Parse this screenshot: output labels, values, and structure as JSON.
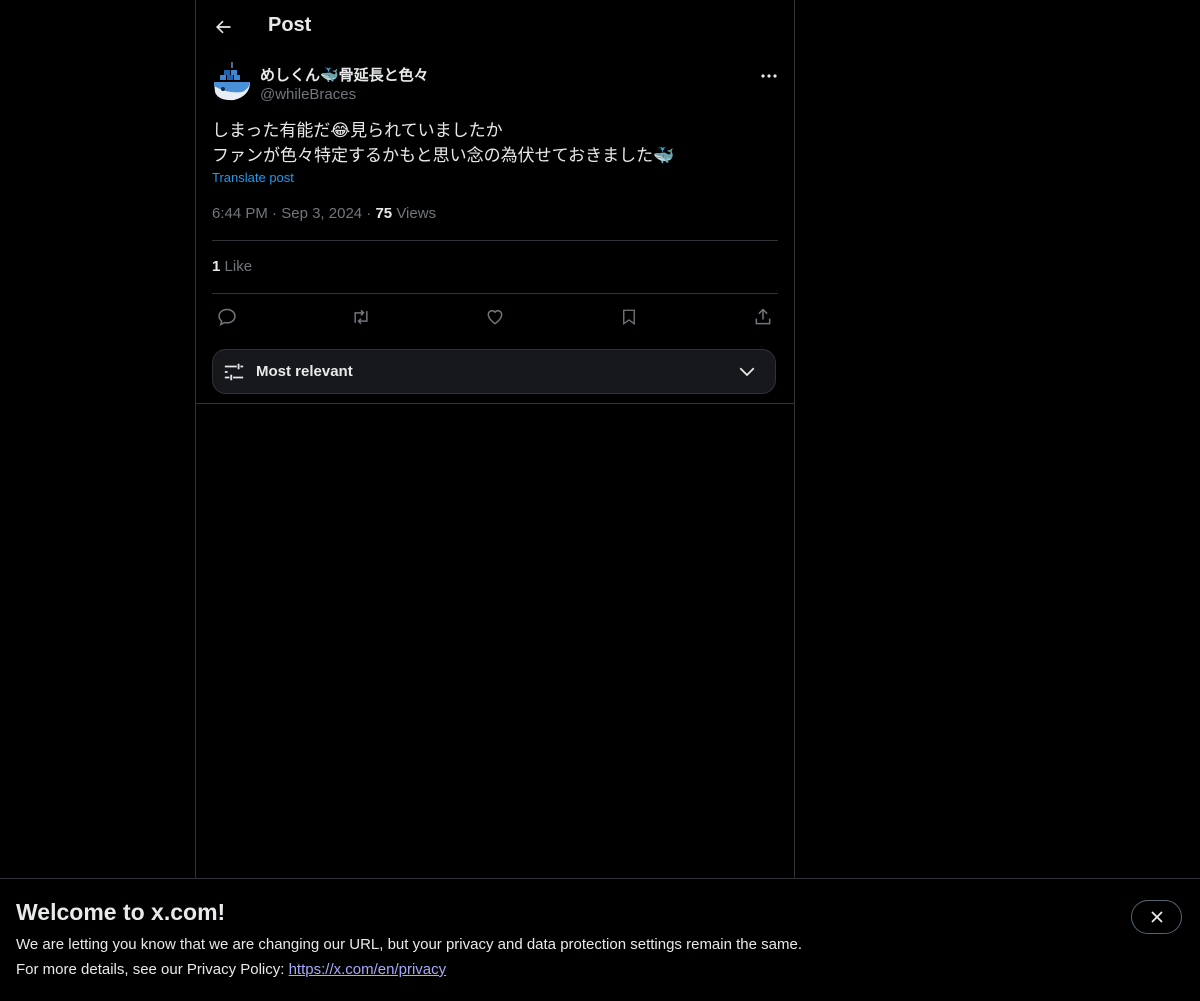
{
  "header": {
    "title": "Post",
    "back_icon": "arrow-left-icon"
  },
  "post": {
    "author_name": "めしくん🐳骨延長と色々",
    "author_handle": "@whileBraces",
    "text": "しまった有能だ😂見られていましたか\nファンが色々特定するかもと思い念の為伏せておきました🐳",
    "translate_label": "Translate post",
    "time": "6:44 PM",
    "date": "Sep 3, 2024",
    "views_count": "75",
    "views_label": "Views",
    "likes_count": "1",
    "likes_label": "Like"
  },
  "actions": [
    "reply-icon",
    "repost-icon",
    "like-icon",
    "bookmark-icon",
    "share-icon"
  ],
  "sort": {
    "label": "Most relevant"
  },
  "banner": {
    "title": "Welcome to x.com!",
    "line1": "We are letting you know that we are changing our URL, but your privacy and data protection settings remain the same.",
    "line2_prefix": "For more details, see our Privacy Policy: ",
    "link": "https://x.com/en/privacy"
  },
  "colors": {
    "background": "#000000",
    "text": "#e7e9ea",
    "muted": "#71767b",
    "accent": "#1d9bf0"
  }
}
